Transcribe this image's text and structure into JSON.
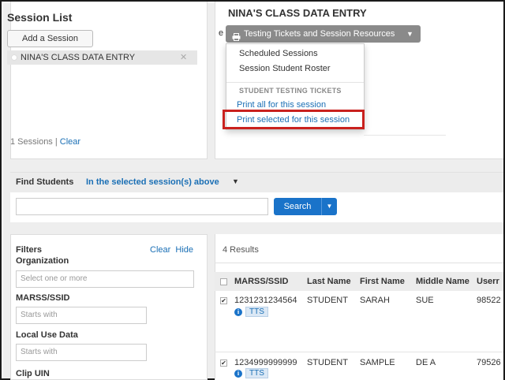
{
  "session_list": {
    "title": "Session List",
    "add_button": "Add a Session",
    "sessions": [
      {
        "name": "NINA'S CLASS DATA ENTRY",
        "remove": "✕"
      }
    ],
    "footer_count": "1 Sessions |",
    "footer_clear": "Clear"
  },
  "session_detail": {
    "title": "NINA'S CLASS DATA ENTRY",
    "prefix_fragment": "e",
    "resources_button": "Testing Tickets and Session Resources",
    "menu": {
      "scheduled": "Scheduled Sessions",
      "roster": "Session Student Roster",
      "tickets_header": "STUDENT TESTING TICKETS",
      "print_all": "Print all for this session",
      "print_selected": "Print selected for this session"
    }
  },
  "find_students": {
    "label": "Find Students",
    "scope": "In the selected session(s) above",
    "search_value": "",
    "search_button": "Search"
  },
  "filters": {
    "title": "Filters",
    "clear_hide": "Clear  Hide",
    "organization_label": "Organization",
    "organization_placeholder": "Select one or more",
    "marss_label": "MARSS/SSID",
    "marss_placeholder": "Starts with",
    "local_use_label": "Local Use Data",
    "local_use_placeholder": "Starts with",
    "clip_label": "Clip UIN"
  },
  "results": {
    "count_text": "4 Results",
    "columns": [
      "MARSS/SSID",
      "Last Name",
      "First Name",
      "Middle Name",
      "Userr"
    ],
    "rows": [
      {
        "checked": true,
        "ssid": "1231231234564",
        "last": "STUDENT",
        "first": "SARAH",
        "middle": "SUE",
        "user": "98522",
        "badge": "TTS"
      },
      {
        "checked": true,
        "ssid": "1234999999999",
        "last": "STUDENT",
        "first": "SAMPLE",
        "middle": "DE A",
        "user": "79526",
        "badge": "TTS"
      }
    ]
  },
  "colors": {
    "link": "#1a6fb5",
    "primary_button": "#1a73c9",
    "resources_button": "#8a8a8a",
    "highlight": "#c9211e"
  },
  "icons": {
    "printer": "printer-icon",
    "caret": "caret-down-icon",
    "info": "info-icon",
    "remove": "close-icon"
  }
}
